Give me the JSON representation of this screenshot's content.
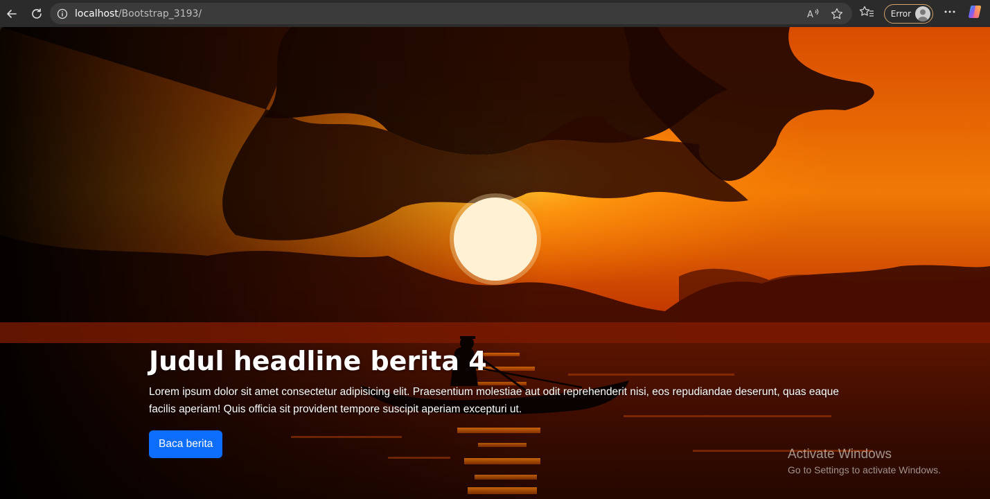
{
  "browser": {
    "url_host": "localhost",
    "url_path": "/Bootstrap_3193/",
    "profile_status": "Error",
    "icons": {
      "back": "back-arrow-icon",
      "reload": "reload-icon",
      "info": "info-icon",
      "read_aloud": "read-aloud-icon",
      "favorite": "star-icon",
      "favorites": "favorites-icon",
      "profile": "avatar-icon",
      "menu": "more-icon",
      "copilot": "copilot-icon"
    }
  },
  "carousel": {
    "headline": "Judul headline berita 4",
    "lead": "Lorem ipsum dolor sit amet consectetur adipisicing elit. Praesentium molestiae aut odit reprehenderit nisi, eos repudiandae deserunt, quas eaque facilis aperiam! Quis officia sit provident tempore suscipit aperiam excepturi ut.",
    "button_label": "Baca berita",
    "button_color": "#0d6efd"
  },
  "watermark": {
    "title": "Activate Windows",
    "subtitle": "Go to Settings to activate Windows."
  }
}
